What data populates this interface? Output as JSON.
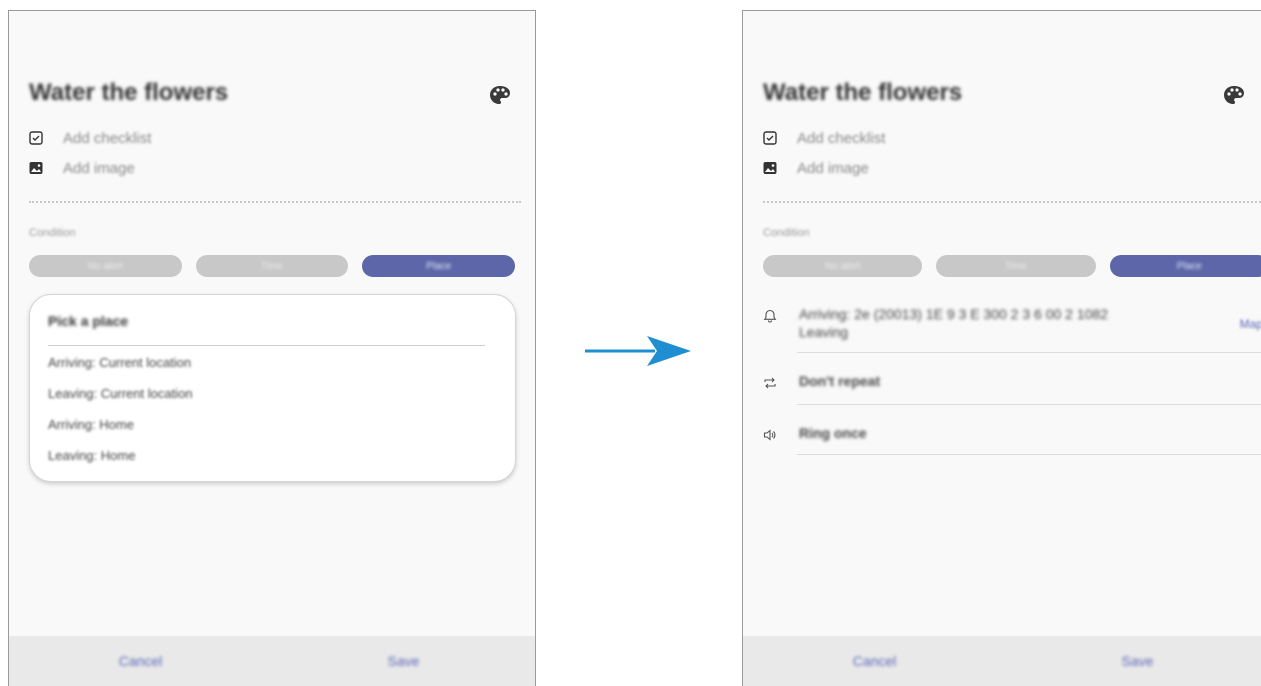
{
  "left": {
    "title": "Water the flowers",
    "add_checklist": "Add checklist",
    "add_image": "Add image",
    "section_label": "Condition",
    "condition_pills": [
      "No alert",
      "Time",
      "Place"
    ],
    "popup": {
      "title": "Pick a place",
      "items": [
        "Arriving: Current location",
        "Leaving: Current location",
        "Arriving: Home",
        "Leaving: Home"
      ]
    },
    "footer": {
      "cancel": "Cancel",
      "save": "Save"
    }
  },
  "right": {
    "title": "Water the flowers",
    "add_checklist": "Add checklist",
    "add_image": "Add image",
    "section_label": "Condition",
    "condition_pills": [
      "No alert",
      "Time",
      "Place"
    ],
    "location_line1": "Arriving: 2e (20013) 1E 9 3 E 300 2 3 6 00 2 1082",
    "location_line2": "Leaving",
    "map_link": "Map",
    "repeat": "Don't repeat",
    "sound": "Ring once",
    "footer": {
      "cancel": "Cancel",
      "save": "Save"
    }
  },
  "colors": {
    "accent": "#5c66a8",
    "arrow": "#1f8fd1",
    "footer_bg": "#e9e9e9"
  }
}
